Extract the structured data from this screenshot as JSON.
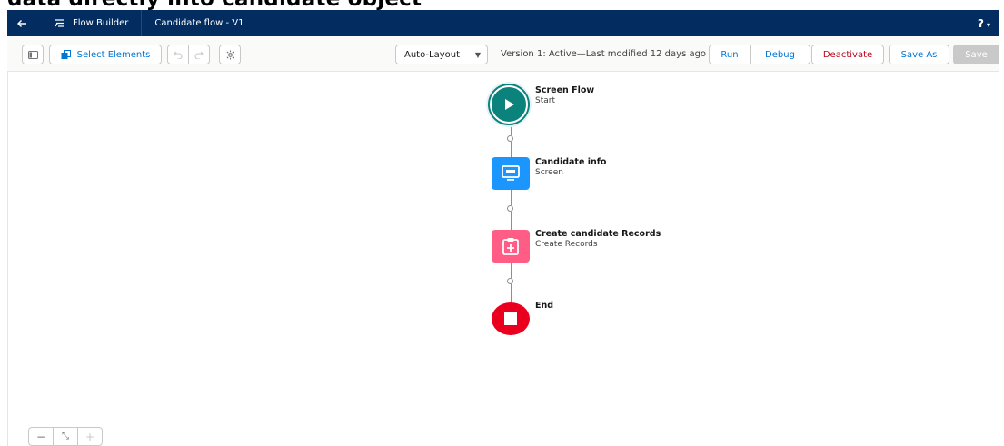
{
  "partial_heading": "data directly into  candidate object",
  "header": {
    "app_name": "Flow Builder",
    "flow_name": "Candidate flow - V1",
    "help_label": "?",
    "help_caret": "▾",
    "back_icon": "arrow-left-icon",
    "app_icon": "flow-icon",
    "bg_color": "#032d60"
  },
  "toolbar": {
    "select_elements": "Select Elements",
    "layout_select": {
      "value": "Auto-Layout"
    },
    "version_text": "Version 1: Active—Last modified 12 days ago",
    "run": "Run",
    "debug": "Debug",
    "deactivate": "Deactivate",
    "save_as": "Save As",
    "save": "Save"
  },
  "flow": {
    "nodes": [
      {
        "title": "Screen Flow",
        "subtitle": "Start",
        "type": "start",
        "color": "#0b827c"
      },
      {
        "title": "Candidate info",
        "subtitle": "Screen",
        "type": "screen",
        "color": "#1b96ff"
      },
      {
        "title": "Create candidate Records",
        "subtitle": "Create Records",
        "type": "create-records",
        "color": "#ff5d85"
      },
      {
        "title": "End",
        "subtitle": "",
        "type": "end",
        "color": "#ea001e"
      }
    ]
  },
  "zoom_controls": {
    "zoom_out": "−",
    "fit": "⤡",
    "zoom_in": "+"
  }
}
